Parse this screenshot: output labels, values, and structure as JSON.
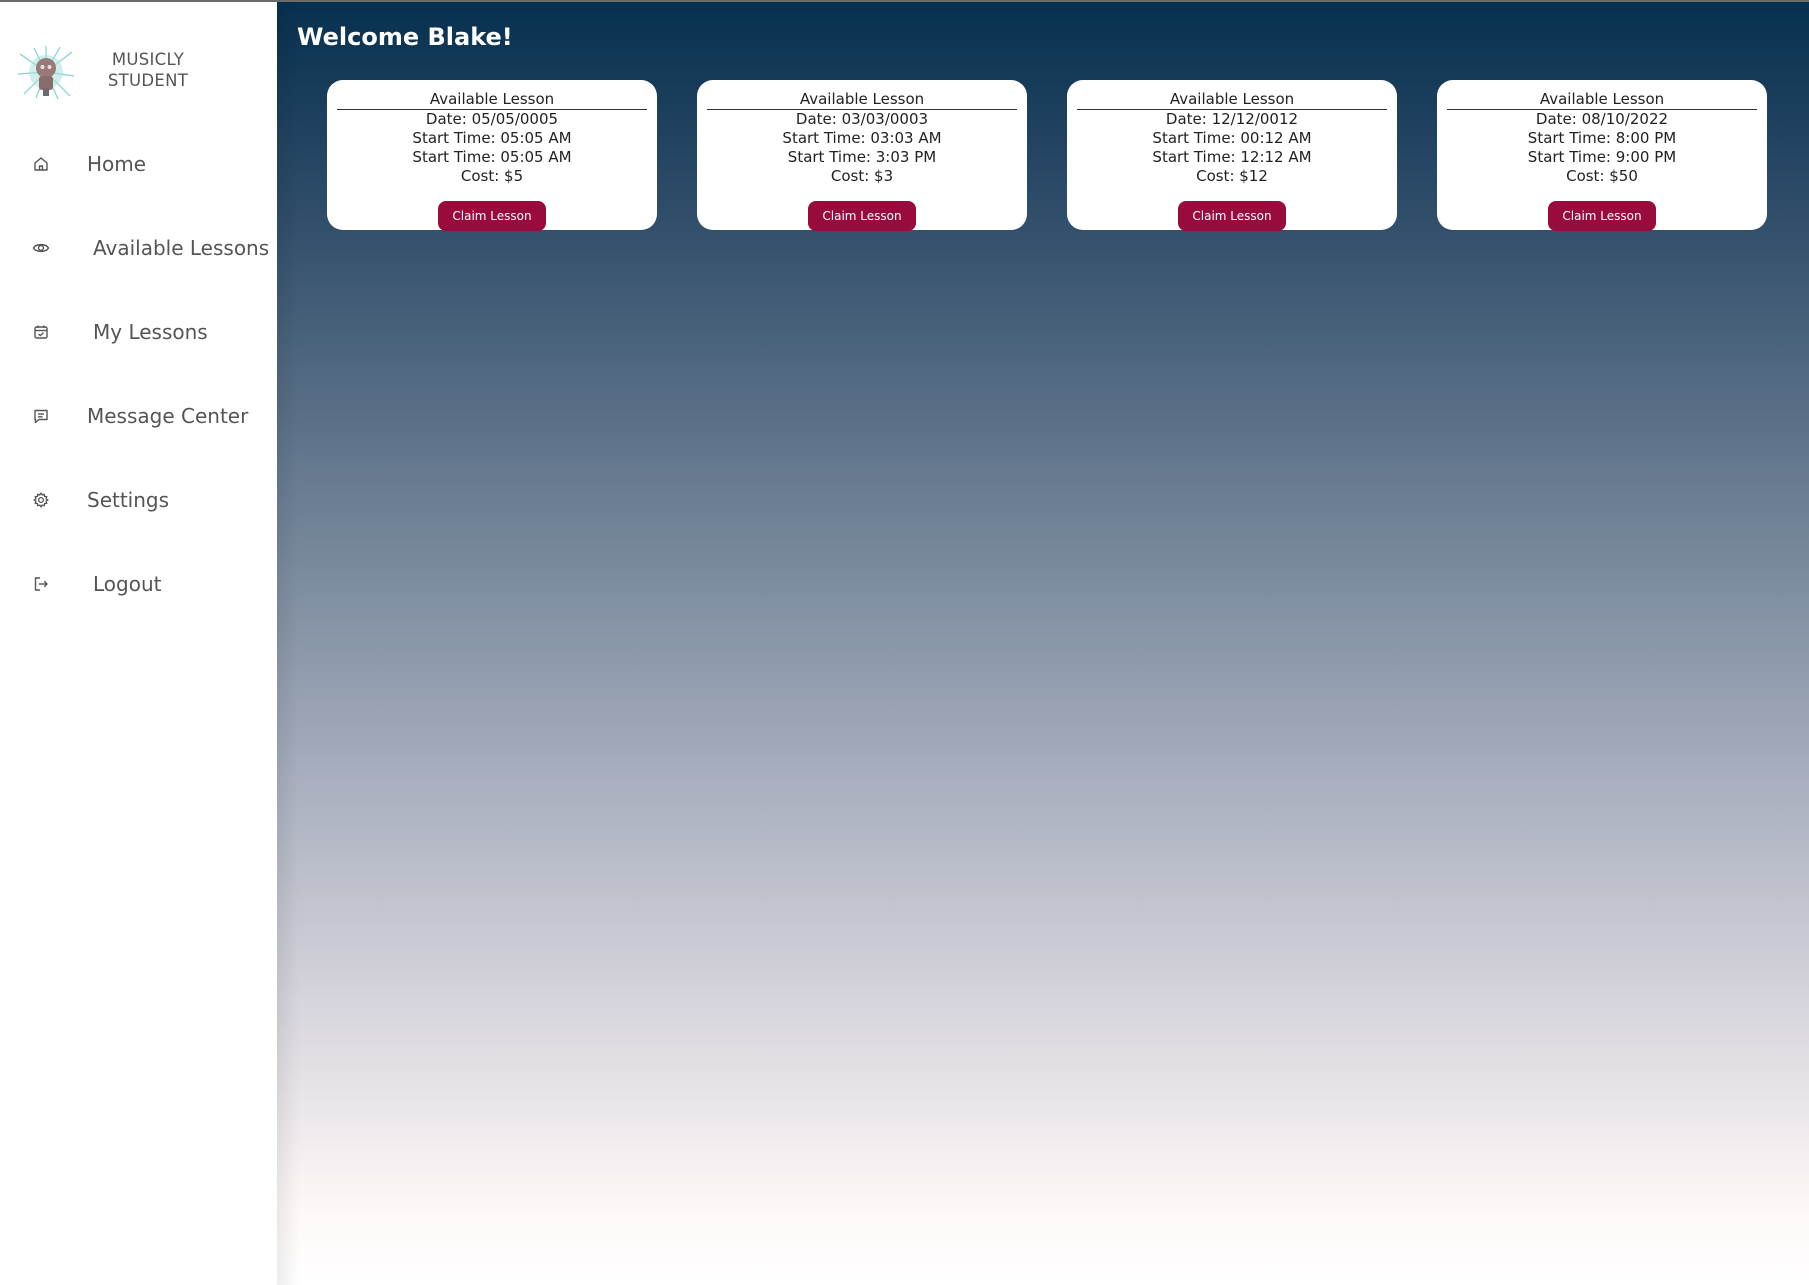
{
  "brand": {
    "line1": "MUSICLY",
    "line2": "STUDENT",
    "logo_icon": "robot-avatar-logo"
  },
  "sidebar": {
    "items": [
      {
        "label": "Home",
        "icon": "home-icon"
      },
      {
        "label": "Available Lessons",
        "icon": "eye-icon"
      },
      {
        "label": "My Lessons",
        "icon": "calendar-check-icon"
      },
      {
        "label": "Message Center",
        "icon": "message-icon"
      },
      {
        "label": "Settings",
        "icon": "gear-icon"
      },
      {
        "label": "Logout",
        "icon": "logout-icon"
      }
    ]
  },
  "main": {
    "welcome": "Welcome Blake!"
  },
  "lessons": [
    {
      "title": "Available Lesson",
      "date": "Date: 05/05/0005",
      "start": "Start Time: 05:05 AM",
      "start2": "Start Time: 05:05 AM",
      "cost": "Cost: $5",
      "button": "Claim Lesson"
    },
    {
      "title": "Available Lesson",
      "date": "Date: 03/03/0003",
      "start": "Start Time: 03:03 AM",
      "start2": "Start Time: 3:03 PM",
      "cost": "Cost: $3",
      "button": "Claim Lesson"
    },
    {
      "title": "Available Lesson",
      "date": "Date: 12/12/0012",
      "start": "Start Time: 00:12 AM",
      "start2": "Start Time: 12:12 AM",
      "cost": "Cost: $12",
      "button": "Claim Lesson"
    },
    {
      "title": "Available Lesson",
      "date": "Date: 08/10/2022",
      "start": "Start Time: 8:00 PM",
      "start2": "Start Time: 9:00 PM",
      "cost": "Cost: $50",
      "button": "Claim Lesson"
    }
  ],
  "colors": {
    "accent_button": "#990a3d",
    "gradient_top": "#07304f",
    "gradient_bottom": "#ffffff",
    "sidebar_text": "#555555"
  }
}
